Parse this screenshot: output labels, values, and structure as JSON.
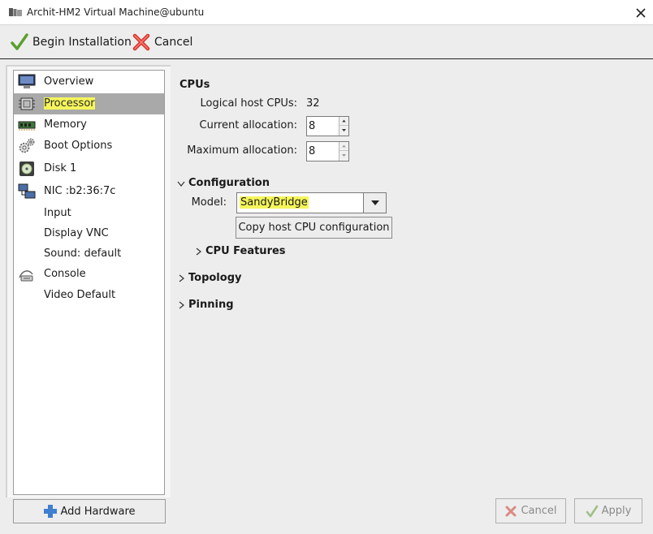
{
  "window": {
    "title": "Archit-HM2 Virtual Machine@ubuntu"
  },
  "toolbar": {
    "begin_label": "Begin Installation",
    "cancel_label": "Cancel"
  },
  "sidebar": {
    "items": [
      {
        "label": "Overview",
        "icon": "monitor-icon"
      },
      {
        "label": "Processor",
        "icon": "cpu-chip-icon",
        "selected": true
      },
      {
        "label": "Memory",
        "icon": "memory-icon"
      },
      {
        "label": "Boot Options",
        "icon": "gears-icon"
      },
      {
        "label": "Disk 1",
        "icon": "disk-icon"
      },
      {
        "label": "NIC :b2:36:7c",
        "icon": "network-icon"
      },
      {
        "label": "Input",
        "icon": ""
      },
      {
        "label": "Display VNC",
        "icon": ""
      },
      {
        "label": "Sound: default",
        "icon": ""
      },
      {
        "label": "Console",
        "icon": "serial-cable-icon"
      },
      {
        "label": "Video Default",
        "icon": ""
      }
    ],
    "add_hardware_label": "Add Hardware"
  },
  "cpus": {
    "title": "CPUs",
    "logical_label": "Logical host CPUs:",
    "logical_value": "32",
    "current_label": "Current allocation:",
    "current_value": "8",
    "maximum_label": "Maximum allocation:",
    "maximum_value": "8"
  },
  "configuration": {
    "title": "Configuration",
    "model_label": "Model:",
    "model_value": "SandyBridge",
    "copy_button_label": "Copy host CPU configuration",
    "cpu_features_label": "CPU Features"
  },
  "topology": {
    "title": "Topology"
  },
  "pinning": {
    "title": "Pinning"
  },
  "footer": {
    "cancel_label": "Cancel",
    "apply_label": "Apply"
  },
  "colors": {
    "selection_bg": "#a9a9a9",
    "highlight": "#f5f55b",
    "window_bg": "#ededed"
  }
}
